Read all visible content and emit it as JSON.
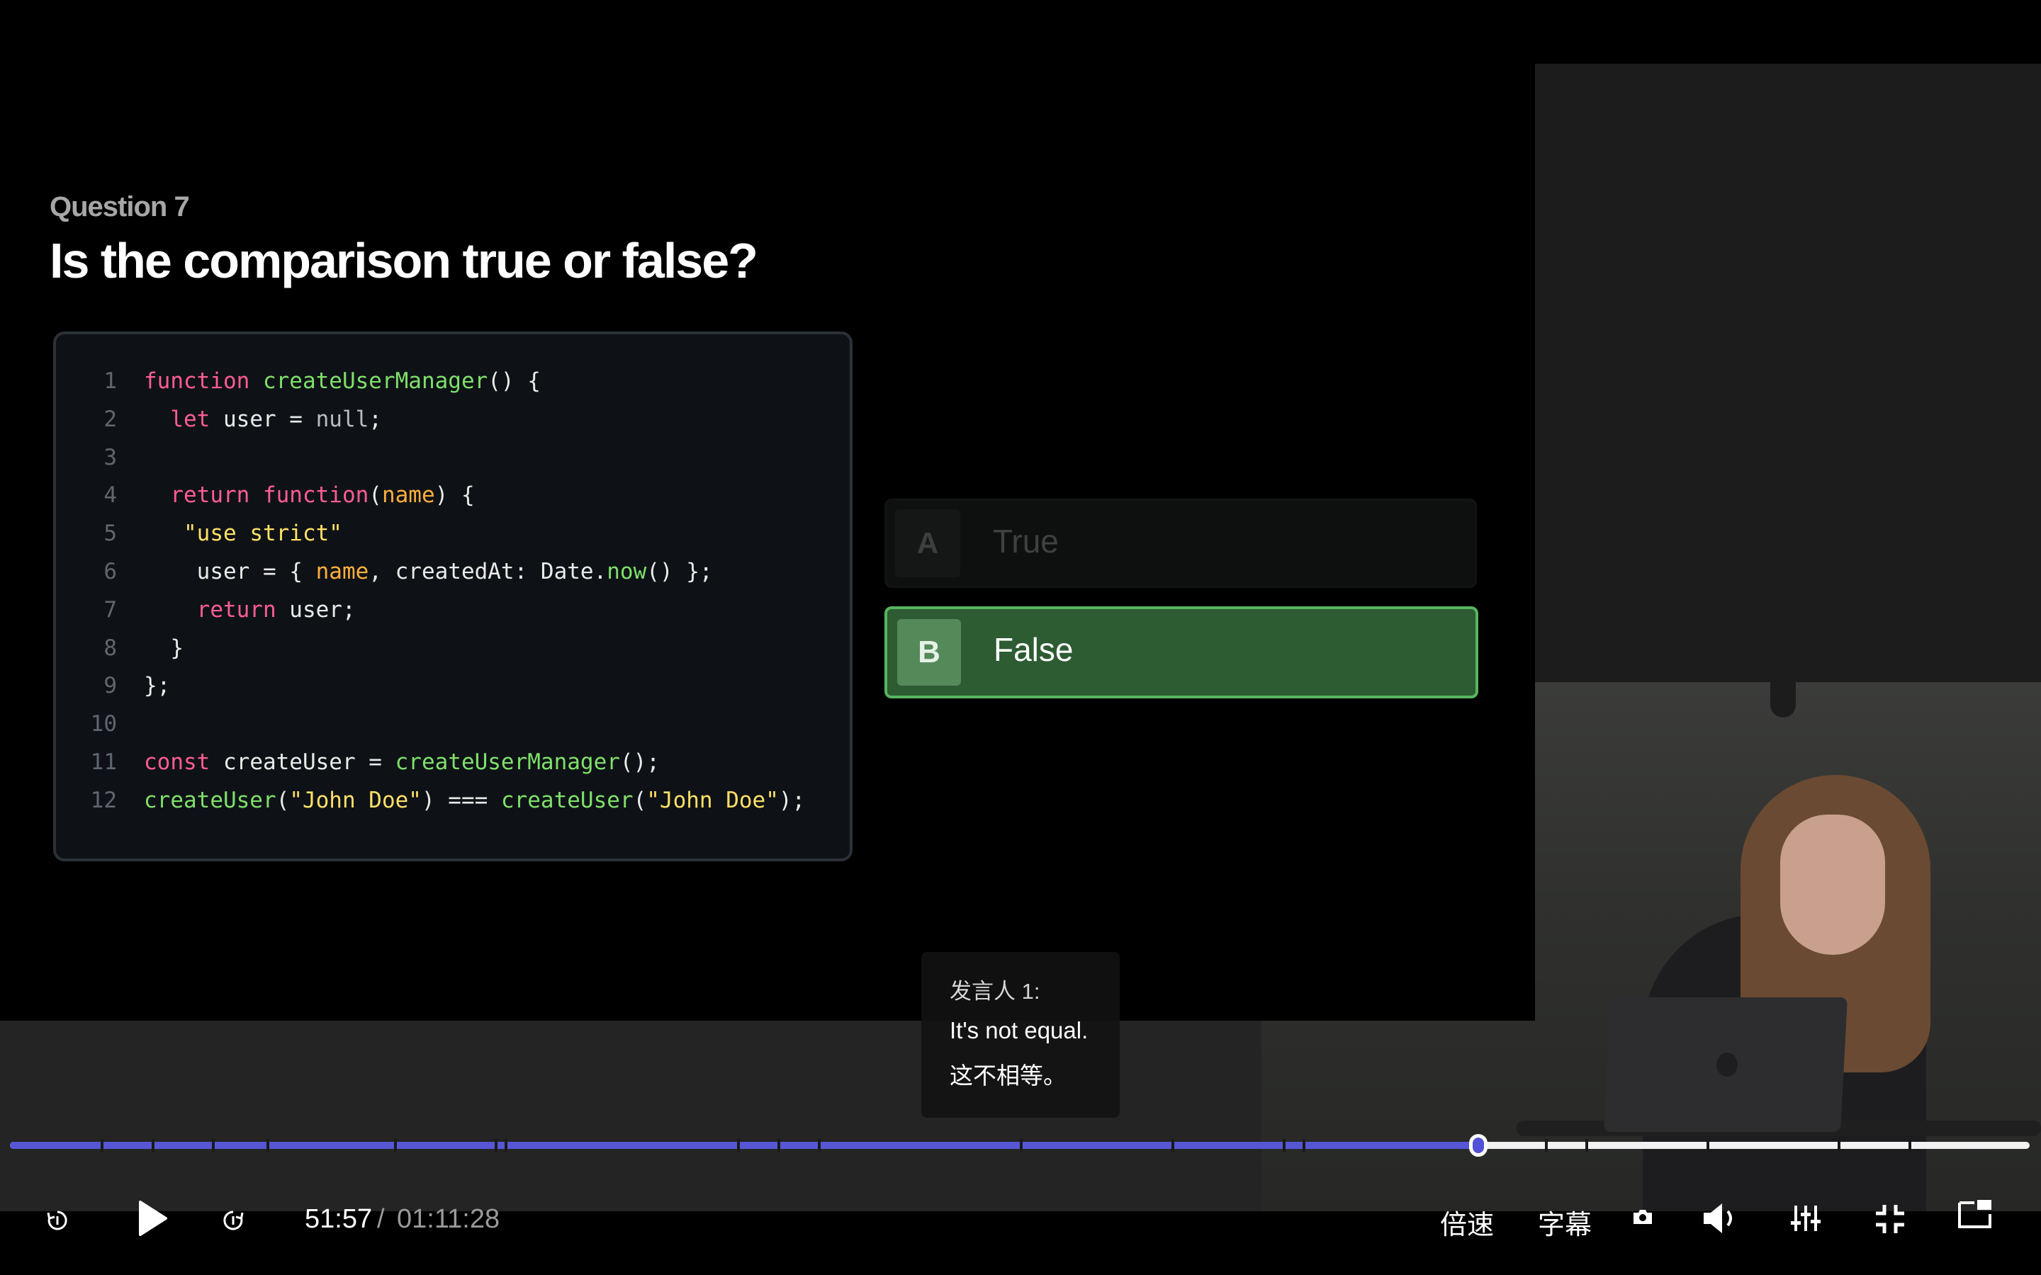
{
  "slide": {
    "question_label": "Question 7",
    "question_title": "Is the comparison true or false?"
  },
  "code": [
    {
      "n": "1",
      "tokens": [
        [
          "kw",
          "function"
        ],
        [
          "p",
          " "
        ],
        [
          "fn",
          "createUserManager"
        ],
        [
          "p",
          "() {"
        ]
      ]
    },
    {
      "n": "2",
      "tokens": [
        [
          "p",
          "  "
        ],
        [
          "kw",
          "let"
        ],
        [
          "p",
          " user = "
        ],
        [
          "dim",
          "null"
        ],
        [
          "p",
          ";"
        ]
      ]
    },
    {
      "n": "3",
      "tokens": []
    },
    {
      "n": "4",
      "tokens": [
        [
          "p",
          "  "
        ],
        [
          "kw",
          "return"
        ],
        [
          "p",
          " "
        ],
        [
          "kw",
          "function"
        ],
        [
          "p",
          "("
        ],
        [
          "par",
          "name"
        ],
        [
          "p",
          ") {"
        ]
      ]
    },
    {
      "n": "5",
      "tokens": [
        [
          "p",
          "   "
        ],
        [
          "str",
          "\"use strict\""
        ]
      ]
    },
    {
      "n": "6",
      "tokens": [
        [
          "p",
          "    user = { "
        ],
        [
          "par",
          "name"
        ],
        [
          "p",
          ", createdAt: Date."
        ],
        [
          "fn",
          "now"
        ],
        [
          "p",
          "() };"
        ]
      ]
    },
    {
      "n": "7",
      "tokens": [
        [
          "p",
          "    "
        ],
        [
          "kw",
          "return"
        ],
        [
          "p",
          " user;"
        ]
      ]
    },
    {
      "n": "8",
      "tokens": [
        [
          "p",
          "  }"
        ]
      ]
    },
    {
      "n": "9",
      "tokens": [
        [
          "p",
          "};"
        ]
      ]
    },
    {
      "n": "10",
      "tokens": []
    },
    {
      "n": "11",
      "tokens": [
        [
          "kw",
          "const"
        ],
        [
          "p",
          " createUser = "
        ],
        [
          "fn",
          "createUserManager"
        ],
        [
          "p",
          "();"
        ]
      ]
    },
    {
      "n": "12",
      "tokens": [
        [
          "fn",
          "createUser"
        ],
        [
          "p",
          "("
        ],
        [
          "str",
          "\"John Doe\""
        ],
        [
          "p",
          ") === "
        ],
        [
          "fn",
          "createUser"
        ],
        [
          "p",
          "("
        ],
        [
          "str",
          "\"John Doe\""
        ],
        [
          "p",
          ");"
        ]
      ]
    }
  ],
  "options": {
    "a": {
      "letter": "A",
      "label": "True",
      "selected": false
    },
    "b": {
      "letter": "B",
      "label": "False",
      "selected": true
    }
  },
  "subtitle": {
    "speaker": "发言人 1:",
    "english": "It's not equal.",
    "chinese": "这不相等。"
  },
  "player": {
    "current_time": "51:57",
    "separator": "/",
    "total_time": "01:11:28",
    "progress_fraction": 0.7269,
    "speed_label": "倍速",
    "caption_label": "字幕",
    "accent_color": "#5757d6",
    "icons": [
      "rewind-icon",
      "play-icon",
      "forward-icon",
      "screenshot-icon",
      "volume-icon",
      "equalizer-icon",
      "exit-fullscreen-icon",
      "picture-in-picture-icon"
    ]
  }
}
